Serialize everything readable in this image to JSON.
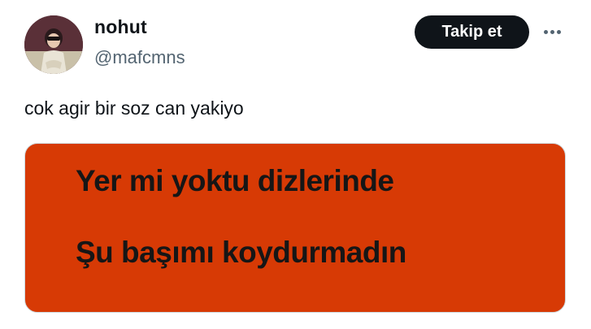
{
  "author": {
    "display_name": "nohut",
    "handle": "@mafcmns",
    "avatar_icon": "profile-photo"
  },
  "actions": {
    "follow_label": "Takip et",
    "more_icon": "more-horizontal-icon"
  },
  "tweet": {
    "text": "cok agir bir soz can yakiyo"
  },
  "media": {
    "background_color": "#d73a05",
    "lines": [
      "Yer mi yoktu dizlerinde",
      "Şu başımı koydurmadın"
    ]
  },
  "colors": {
    "primary_text": "#0f1419",
    "secondary_text": "#536471",
    "follow_button_bg": "#0f1419"
  }
}
